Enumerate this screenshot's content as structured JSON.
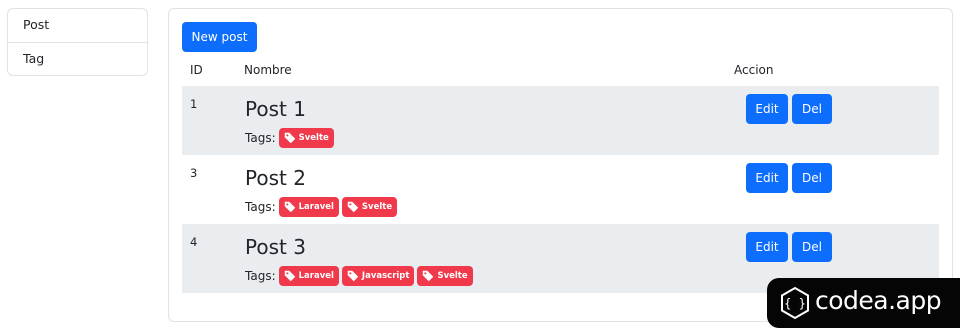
{
  "sidebar": {
    "items": [
      {
        "label": "Post"
      },
      {
        "label": "Tag"
      }
    ]
  },
  "main": {
    "new_button": "New post",
    "columns": {
      "id": "ID",
      "name": "Nombre",
      "action": "Accion"
    },
    "tags_label": "Tags:",
    "edit_label": "Edit",
    "delete_label": "Del",
    "rows": [
      {
        "id": "1",
        "title": "Post 1",
        "tags": [
          "Svelte"
        ]
      },
      {
        "id": "3",
        "title": "Post 2",
        "tags": [
          "Laravel",
          "Svelte"
        ]
      },
      {
        "id": "4",
        "title": "Post 3",
        "tags": [
          "Laravel",
          "Javascript",
          "Svelte"
        ]
      }
    ]
  },
  "branding": {
    "logo_text": "codea.app"
  },
  "colors": {
    "primary": "#0d6efd",
    "tag": "#f03a4b",
    "stripe": "#eaedf0"
  }
}
